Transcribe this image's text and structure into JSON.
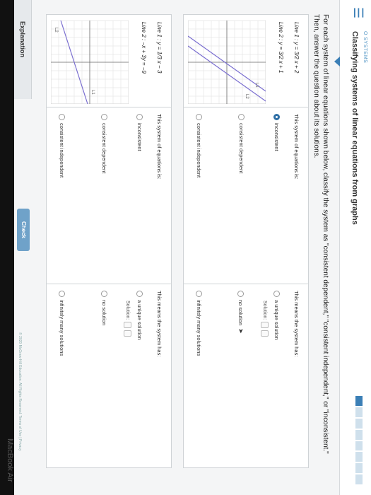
{
  "header": {
    "breadcrumb": "O SYSTEMS",
    "title": "Classifying systems of linear equations from graphs",
    "progress_filled": 0.12,
    "accent": "#3b7fb6"
  },
  "instructions": "For each system of linear equations shown below, classify the system as \"consistent dependent,\" \"consistent independent,\" or \"inconsistent.\" Then, answer the question about its solutions.",
  "problem1": {
    "line1": "Line 1 : y = 3/2 x + 2",
    "line2": "Line 2 : y = 3/2 x + 1",
    "graph_label_1": "L1",
    "graph_label_2": "L2",
    "classify_prompt": "This system of equations is:",
    "classify_options": [
      "inconsistent",
      "consistent dependent",
      "consistent independent"
    ],
    "classify_selected": 0,
    "solutions_prompt": "This means the system has:",
    "solution_options": [
      "a unique solution",
      "no solution",
      "infinitely many solutions"
    ],
    "solution_label": "Solution:"
  },
  "problem2": {
    "line1": "Line 1 : y = 1/3 x − 3",
    "line2": "Line 2 : −x + 3y = −9",
    "graph_label_1": "L2",
    "graph_label_2": "L1",
    "classify_prompt": "This system of equations is:",
    "classify_options": [
      "inconsistent",
      "consistent dependent",
      "consistent independent"
    ],
    "solutions_prompt": "This means the system has:",
    "solution_options": [
      "a unique solution",
      "no solution",
      "infinitely many solutions"
    ],
    "solution_label": "Solution:"
  },
  "footer": {
    "explanation": "Explanation",
    "check": "Check",
    "copyright": "© 2020 McGraw-Hill Education. All Rights Reserved.  Terms of Use  |  Privacy",
    "laptop": "MacBook Air"
  }
}
